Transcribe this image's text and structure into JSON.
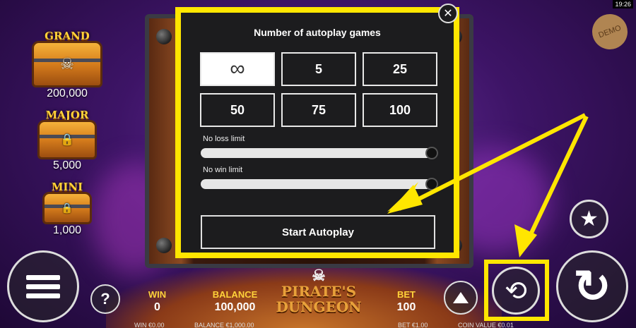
{
  "status": {
    "clock": "19:26"
  },
  "badge": {
    "demo": "DEMO"
  },
  "jackpots": [
    {
      "title": "GRAND",
      "amount": "200,000",
      "emblem": "☠"
    },
    {
      "title": "MAJOR",
      "amount": "5,000",
      "emblem": "🔒"
    },
    {
      "title": "MINI",
      "amount": "1,000",
      "emblem": "🔒"
    }
  ],
  "autoplay_dialog": {
    "title": "Number of autoplay games",
    "options": [
      "∞",
      "5",
      "25",
      "50",
      "75",
      "100"
    ],
    "selected_option": "∞",
    "loss_limit_label": "No loss limit",
    "win_limit_label": "No win limit",
    "loss_limit_fraction": 1.0,
    "win_limit_fraction": 1.0,
    "start_label": "Start Autoplay",
    "close_glyph": "✕"
  },
  "footer": {
    "win_label": "WIN",
    "win_value": "0",
    "win_sub": "WIN €0.00",
    "balance_label": "BALANCE",
    "balance_value": "100,000",
    "balance_sub": "BALANCE €1,000.00",
    "bet_label": "BET",
    "bet_value": "100",
    "bet_sub": "BET €1.00",
    "coin_sub": "COIN VALUE €0.01"
  },
  "logo": {
    "line1": "PIRATE'S",
    "line2": "DUNGEON"
  },
  "buttons": {
    "help_glyph": "?",
    "star_glyph": "★",
    "spin_glyph": "↻",
    "autoplay_glyph": "⟲"
  },
  "colors": {
    "highlight": "#ffe600",
    "gold_text": "#ffd23a",
    "dialog_bg": "#1c1c1e"
  },
  "icons": [
    "menu-icon",
    "help-icon",
    "star-icon",
    "spin-icon",
    "autoplay-icon",
    "bet-up-icon",
    "close-icon",
    "infinity-icon"
  ]
}
